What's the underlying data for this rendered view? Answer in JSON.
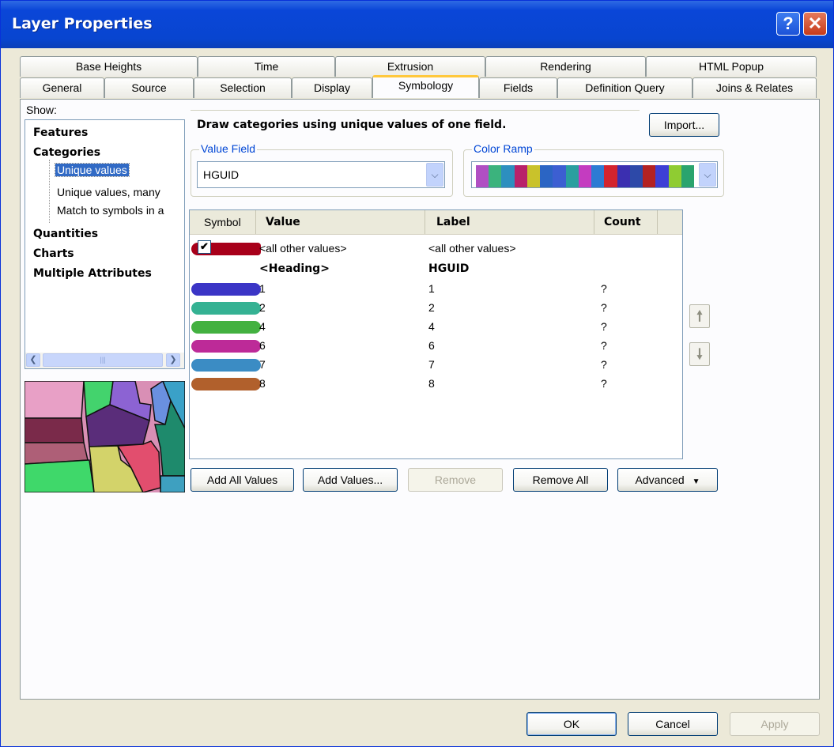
{
  "window": {
    "title": "Layer Properties",
    "help_label": "?",
    "close_label": "✕"
  },
  "tabs_row1": [
    "Base Heights",
    "Time",
    "Extrusion",
    "Rendering",
    "HTML Popup"
  ],
  "tabs_row2": [
    "General",
    "Source",
    "Selection",
    "Display",
    "Symbology",
    "Fields",
    "Definition Query",
    "Joins & Relates"
  ],
  "active_tab": "Symbology",
  "show": {
    "label": "Show:",
    "items": [
      "Features",
      "Categories",
      "Unique values",
      "Unique values, many",
      "Match to symbols in a",
      "Quantities",
      "Charts",
      "Multiple Attributes"
    ],
    "selected": "Unique values"
  },
  "description": "Draw categories using unique values of one field.",
  "import_button": "Import...",
  "value_field": {
    "label": "Value Field",
    "value": "HGUID"
  },
  "color_ramp": {
    "label": "Color Ramp",
    "colors": [
      "#b04fc3",
      "#3bb37d",
      "#2d8fbf",
      "#b8226a",
      "#c9c22b",
      "#2b65c4",
      "#3c5fd2",
      "#2a9f9f",
      "#c43cc0",
      "#2c7bd3",
      "#d3242e",
      "#3b2fb0",
      "#2d49a8",
      "#b32222",
      "#3d3fd5",
      "#8fcc32",
      "#2aa46e"
    ]
  },
  "table": {
    "headers": {
      "symbol": "Symbol",
      "value": "Value",
      "label": "Label",
      "count": "Count"
    },
    "other_row": {
      "value": "<all other values>",
      "label": "<all other values>",
      "color": "#a8001a",
      "checked": "✔"
    },
    "heading_row": {
      "value": "<Heading>",
      "label": "HGUID"
    },
    "rows": [
      {
        "value": "1",
        "label": "1",
        "count": "?",
        "color": "#3b35c6"
      },
      {
        "value": "2",
        "label": "2",
        "count": "?",
        "color": "#35b293"
      },
      {
        "value": "4",
        "label": "4",
        "count": "?",
        "color": "#43b140"
      },
      {
        "value": "6",
        "label": "6",
        "count": "?",
        "color": "#bd2a98"
      },
      {
        "value": "7",
        "label": "7",
        "count": "?",
        "color": "#3b8cc4"
      },
      {
        "value": "8",
        "label": "8",
        "count": "?",
        "color": "#b1602c"
      }
    ]
  },
  "buttons": {
    "add_all_values": "Add All Values",
    "add_values": "Add Values...",
    "remove": "Remove",
    "remove_all": "Remove All",
    "advanced": "Advanced",
    "ok": "OK",
    "cancel": "Cancel",
    "apply": "Apply"
  },
  "icons": {
    "up": "arrow-up-icon",
    "down": "arrow-down-icon"
  }
}
